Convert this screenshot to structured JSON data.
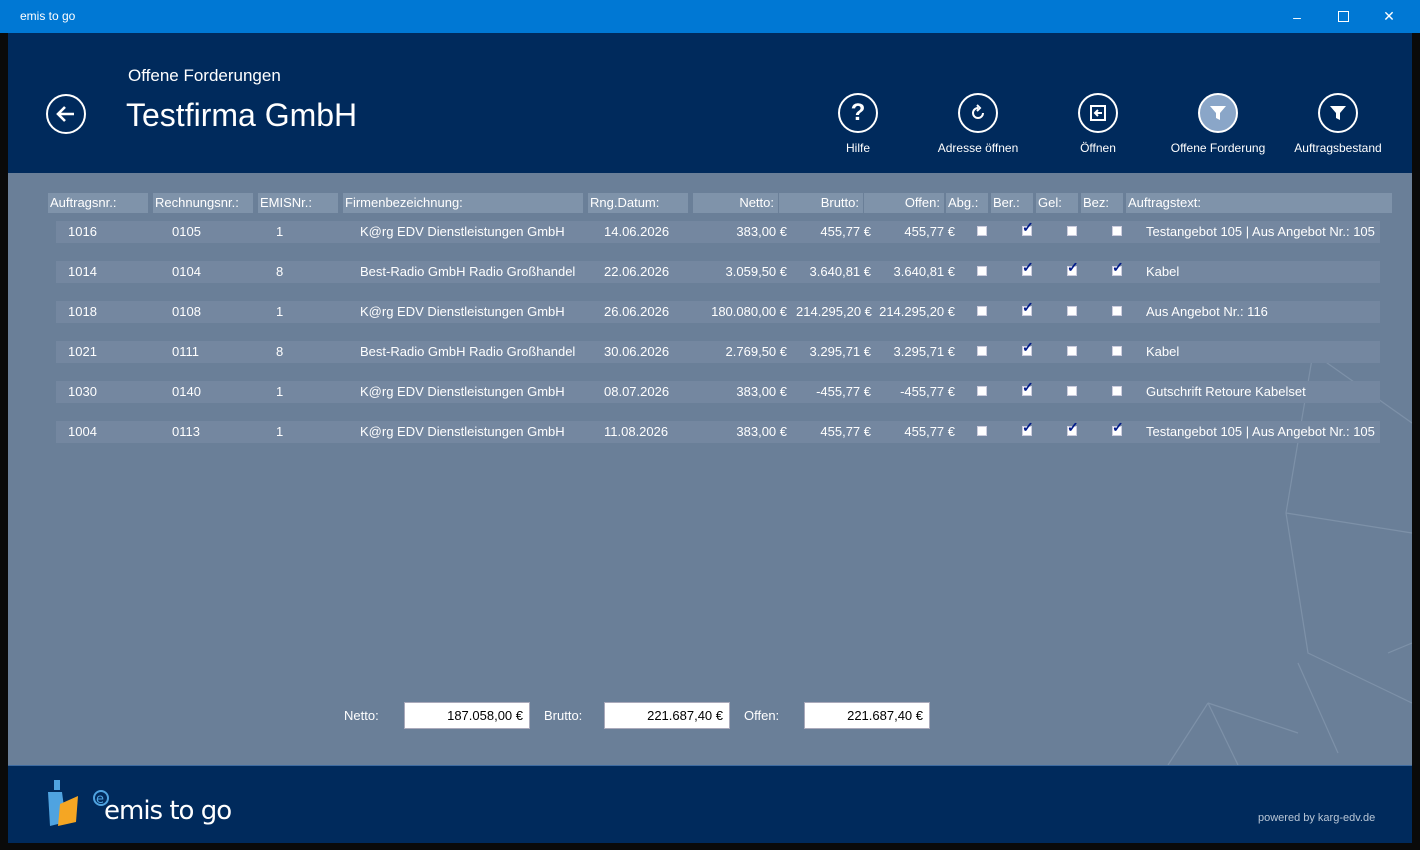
{
  "window": {
    "title": "emis to go"
  },
  "header": {
    "subtitle": "Offene Forderungen",
    "company": "Testfirma GmbH"
  },
  "toolbar": [
    {
      "label": "Hilfe",
      "icon": "help-icon"
    },
    {
      "label": "Adresse öffnen",
      "icon": "refresh-icon"
    },
    {
      "label": "Öffnen",
      "icon": "open-icon"
    },
    {
      "label": "Offene Forderung",
      "icon": "filter-icon"
    },
    {
      "label": "Auftragsbestand",
      "icon": "filter-icon"
    }
  ],
  "table": {
    "headers": {
      "auftragsnr": "Auftragsnr.:",
      "rechnungsnr": "Rechnungsnr.:",
      "emisnr": "EMISNr.:",
      "firma": "Firmenbezeichnung:",
      "datum": "Rng.Datum:",
      "netto": "Netto:",
      "brutto": "Brutto:",
      "offen": "Offen:",
      "abg": "Abg.:",
      "ber": "Ber.:",
      "gel": "Gel:",
      "bez": "Bez:",
      "text": "Auftragstext:"
    },
    "rows": [
      {
        "auftragsnr": "1016",
        "rechnungsnr": "0105",
        "emisnr": "1",
        "firma": "K@rg EDV Dienstleistungen GmbH",
        "datum": "14.06.2026",
        "netto": "383,00 €",
        "brutto": "455,77 €",
        "offen": "455,77 €",
        "abg": false,
        "ber": true,
        "gel": false,
        "bez": false,
        "text": "Testangebot 105 | Aus Angebot Nr.: 105"
      },
      {
        "auftragsnr": "1014",
        "rechnungsnr": "0104",
        "emisnr": "8",
        "firma": "Best-Radio GmbH Radio Großhandel",
        "datum": "22.06.2026",
        "netto": "3.059,50 €",
        "brutto": "3.640,81 €",
        "offen": "3.640,81 €",
        "abg": false,
        "ber": true,
        "gel": true,
        "bez": true,
        "text": "Kabel"
      },
      {
        "auftragsnr": "1018",
        "rechnungsnr": "0108",
        "emisnr": "1",
        "firma": "K@rg EDV Dienstleistungen GmbH",
        "datum": "26.06.2026",
        "netto": "180.080,00 €",
        "brutto": "214.295,20 €",
        "offen": "214.295,20 €",
        "abg": false,
        "ber": true,
        "gel": false,
        "bez": false,
        "text": "Aus Angebot Nr.: 116"
      },
      {
        "auftragsnr": "1021",
        "rechnungsnr": "0111",
        "emisnr": "8",
        "firma": "Best-Radio GmbH Radio Großhandel",
        "datum": "30.06.2026",
        "netto": "2.769,50 €",
        "brutto": "3.295,71 €",
        "offen": "3.295,71 €",
        "abg": false,
        "ber": true,
        "gel": false,
        "bez": false,
        "text": "Kabel"
      },
      {
        "auftragsnr": "1030",
        "rechnungsnr": "0140",
        "emisnr": "1",
        "firma": "K@rg EDV Dienstleistungen GmbH",
        "datum": "08.07.2026",
        "netto": "383,00 €",
        "brutto": "-455,77 €",
        "offen": "-455,77 €",
        "abg": false,
        "ber": true,
        "gel": false,
        "bez": false,
        "text": "Gutschrift Retoure Kabelset"
      },
      {
        "auftragsnr": "1004",
        "rechnungsnr": "0113",
        "emisnr": "1",
        "firma": "K@rg EDV Dienstleistungen GmbH",
        "datum": "11.08.2026",
        "netto": "383,00 €",
        "brutto": "455,77 €",
        "offen": "455,77 €",
        "abg": false,
        "ber": true,
        "gel": true,
        "bez": true,
        "text": "Testangebot 105 | Aus Angebot Nr.: 105"
      }
    ]
  },
  "totals": {
    "netto_label": "Netto:",
    "netto_value": "187.058,00 €",
    "brutto_label": "Brutto:",
    "brutto_value": "221.687,40 €",
    "offen_label": "Offen:",
    "offen_value": "221.687,40 €"
  },
  "footer": {
    "logo_text": "emis to go",
    "powered": "powered by karg-edv.de"
  },
  "colors": {
    "titlebar": "#0078d4",
    "header": "#002a5c",
    "content": "#6a7f98",
    "row_band": "#7487a0",
    "check": "#001a88"
  }
}
